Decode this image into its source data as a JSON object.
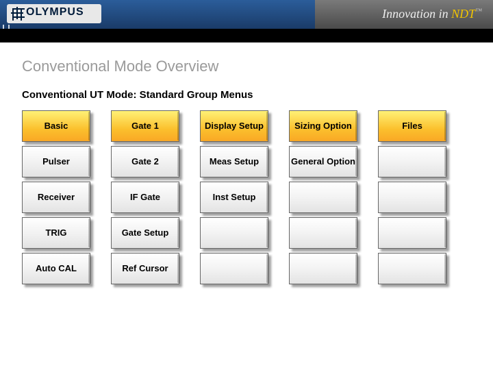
{
  "header": {
    "brand": "OLYMPUS",
    "tagline_prefix": "Innovation in ",
    "tagline_highlight": "NDT",
    "tagline_tm": "™"
  },
  "page": {
    "title": "Conventional Mode Overview",
    "subtitle": "Conventional UT Mode: Standard Group Menus"
  },
  "menus": {
    "columns": [
      {
        "header": "Basic",
        "items": [
          "Pulser",
          "Receiver",
          "TRIG",
          "Auto CAL"
        ]
      },
      {
        "header": "Gate 1",
        "items": [
          "Gate 2",
          "IF Gate",
          "Gate Setup",
          "Ref Cursor"
        ]
      },
      {
        "header": "Display Setup",
        "items": [
          "Meas Setup",
          "Inst Setup",
          "",
          ""
        ]
      },
      {
        "header": "Sizing Option",
        "items": [
          "General Option",
          "",
          "",
          ""
        ]
      },
      {
        "header": "Files",
        "items": [
          "",
          "",
          "",
          ""
        ]
      }
    ]
  }
}
